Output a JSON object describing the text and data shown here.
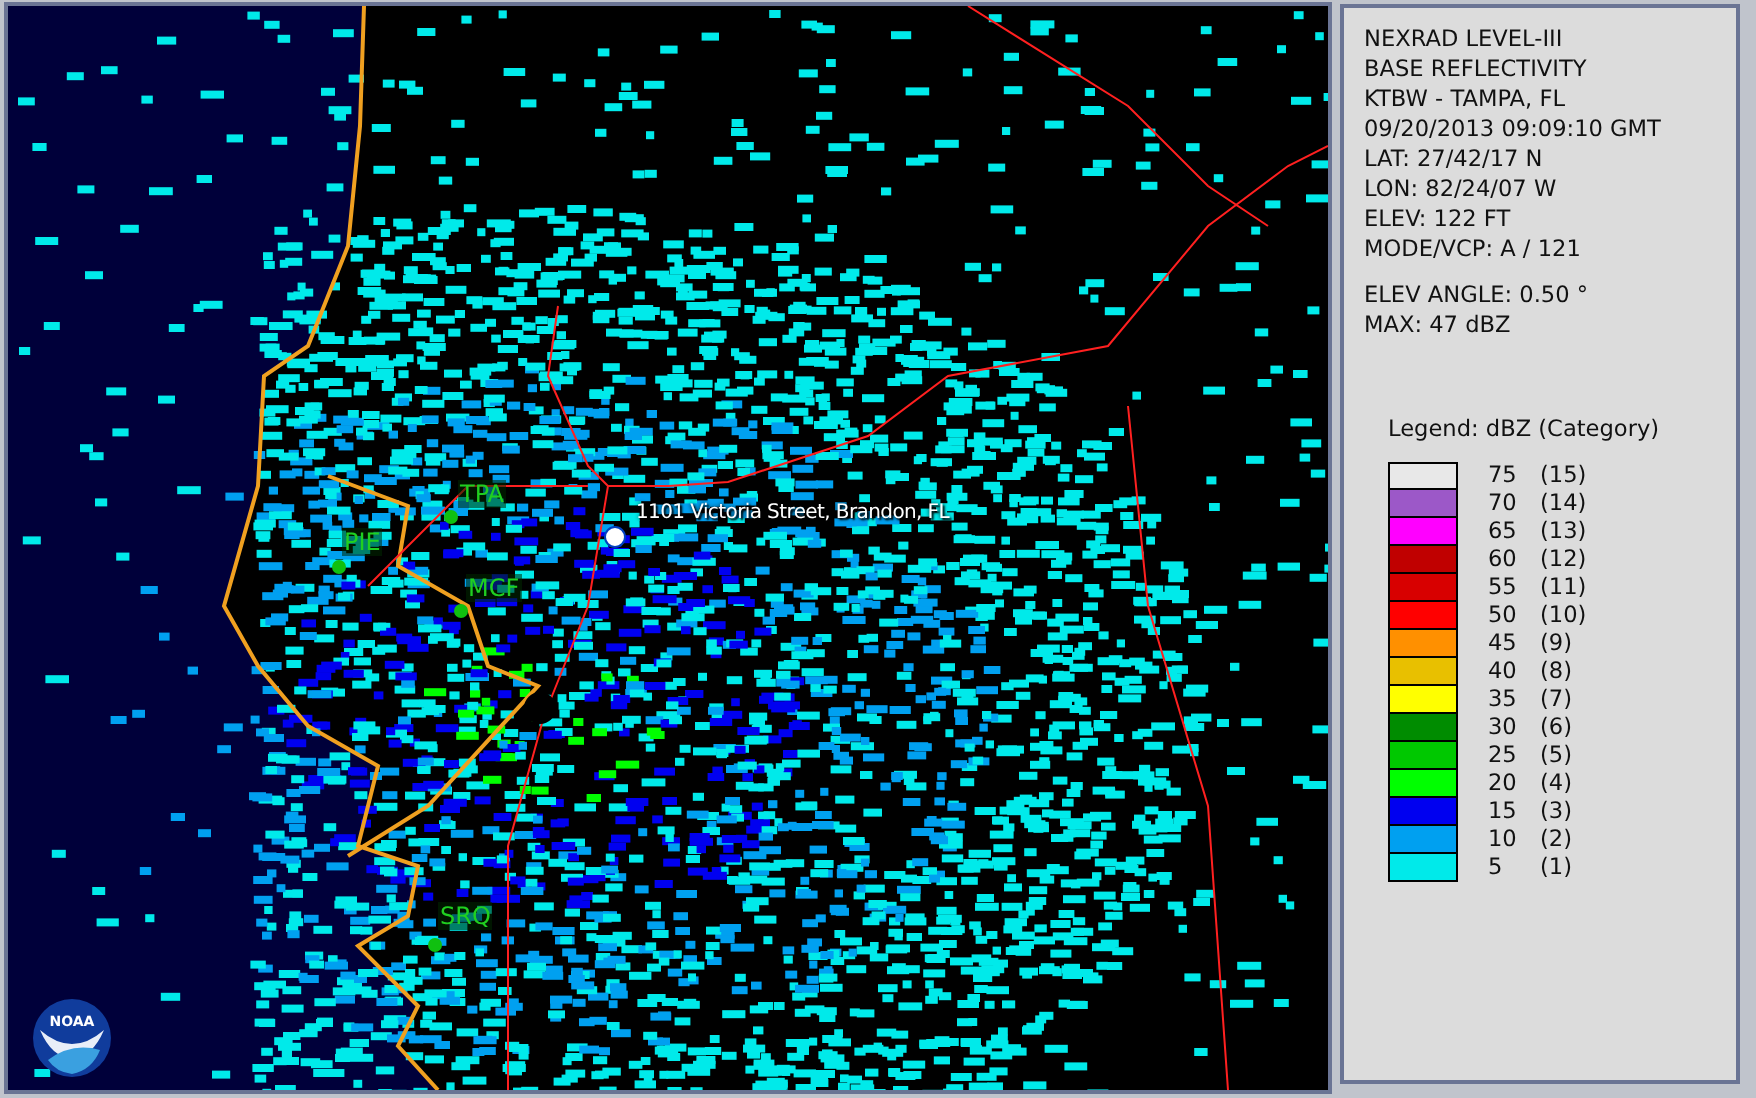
{
  "map": {
    "logo_text": "NOAA",
    "location_label": "1101 Victoria Street, Brandon, FL",
    "cities": [
      {
        "label": "TPA"
      },
      {
        "label": "PIE"
      },
      {
        "label": "MCF"
      },
      {
        "label": "SRQ"
      }
    ]
  },
  "info": {
    "lines": [
      "NEXRAD LEVEL-III",
      "BASE REFLECTIVITY",
      "KTBW - TAMPA, FL",
      "09/20/2013 09:09:10 GMT",
      "LAT: 27/42/17 N",
      "LON: 82/24/07 W",
      "ELEV: 122 FT",
      "MODE/VCP: A / 121"
    ],
    "extra_lines": [
      "ELEV ANGLE: 0.50 °",
      "MAX: 47 dBZ"
    ]
  },
  "legend": {
    "title": "Legend: dBZ (Category)",
    "items": [
      {
        "value": "75",
        "category": "(15)",
        "color": "#e8e8e8"
      },
      {
        "value": "70",
        "category": "(14)",
        "color": "#9c58c8"
      },
      {
        "value": "65",
        "category": "(13)",
        "color": "#ff00ff"
      },
      {
        "value": "60",
        "category": "(12)",
        "color": "#c00000"
      },
      {
        "value": "55",
        "category": "(11)",
        "color": "#d80000"
      },
      {
        "value": "50",
        "category": "(10)",
        "color": "#ff0000"
      },
      {
        "value": "45",
        "category": "(9)",
        "color": "#ff9000"
      },
      {
        "value": "40",
        "category": "(8)",
        "color": "#e8c000"
      },
      {
        "value": "35",
        "category": "(7)",
        "color": "#ffff00"
      },
      {
        "value": "30",
        "category": "(6)",
        "color": "#008c00"
      },
      {
        "value": "25",
        "category": "(5)",
        "color": "#00c800"
      },
      {
        "value": "20",
        "category": "(4)",
        "color": "#00ff00"
      },
      {
        "value": "15",
        "category": "(3)",
        "color": "#0000f0"
      },
      {
        "value": "10",
        "category": "(2)",
        "color": "#00a0f0"
      },
      {
        "value": "5",
        "category": "(1)",
        "color": "#00eaea"
      }
    ]
  }
}
